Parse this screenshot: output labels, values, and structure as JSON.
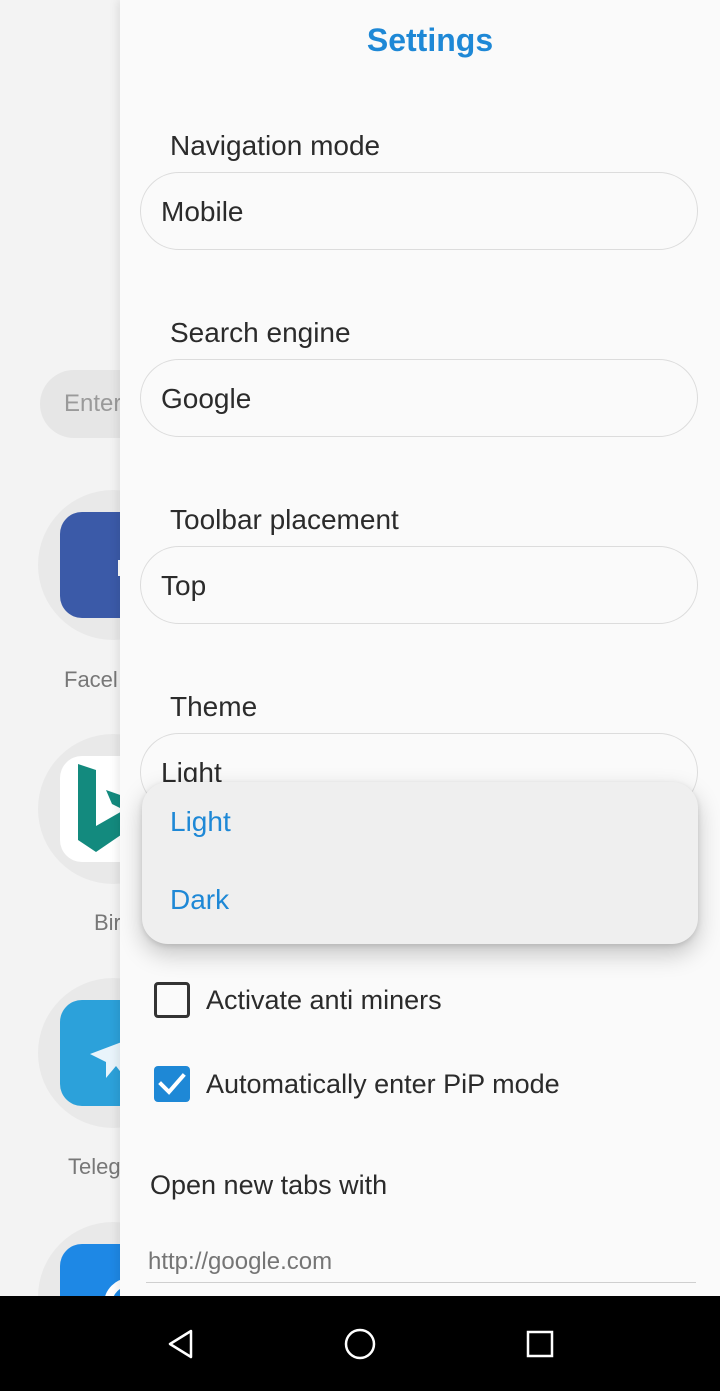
{
  "background": {
    "search_placeholder": "Enter",
    "apps": [
      {
        "label": "Facel",
        "color": "#3b5aa8",
        "icon": "facebook-icon"
      },
      {
        "label": "Bir",
        "color": "#ffffff",
        "icon": "bing-icon"
      },
      {
        "label": "Teleg",
        "color": "#2ca1da",
        "icon": "telegram-icon"
      },
      {
        "label": "",
        "color": "#1e88e5",
        "icon": "app-icon"
      }
    ]
  },
  "settings": {
    "title": "Settings",
    "navigation_mode": {
      "label": "Navigation mode",
      "value": "Mobile"
    },
    "search_engine": {
      "label": "Search engine",
      "value": "Google"
    },
    "toolbar_placement": {
      "label": "Toolbar placement",
      "value": "Top"
    },
    "theme": {
      "label": "Theme",
      "value": "Light",
      "options": [
        "Light",
        "Dark"
      ]
    },
    "anti_miners": {
      "label": "Activate anti miners",
      "checked": false
    },
    "pip_mode": {
      "label": "Automatically enter PiP mode",
      "checked": true
    },
    "new_tabs": {
      "label": "Open new tabs with",
      "placeholder": "http://google.com"
    }
  },
  "colors": {
    "accent": "#1e88d6",
    "panel_bg": "#fafafa",
    "navbar_bg": "#000000"
  },
  "navbar": {
    "icons": [
      "back-icon",
      "home-icon",
      "recents-icon"
    ]
  }
}
